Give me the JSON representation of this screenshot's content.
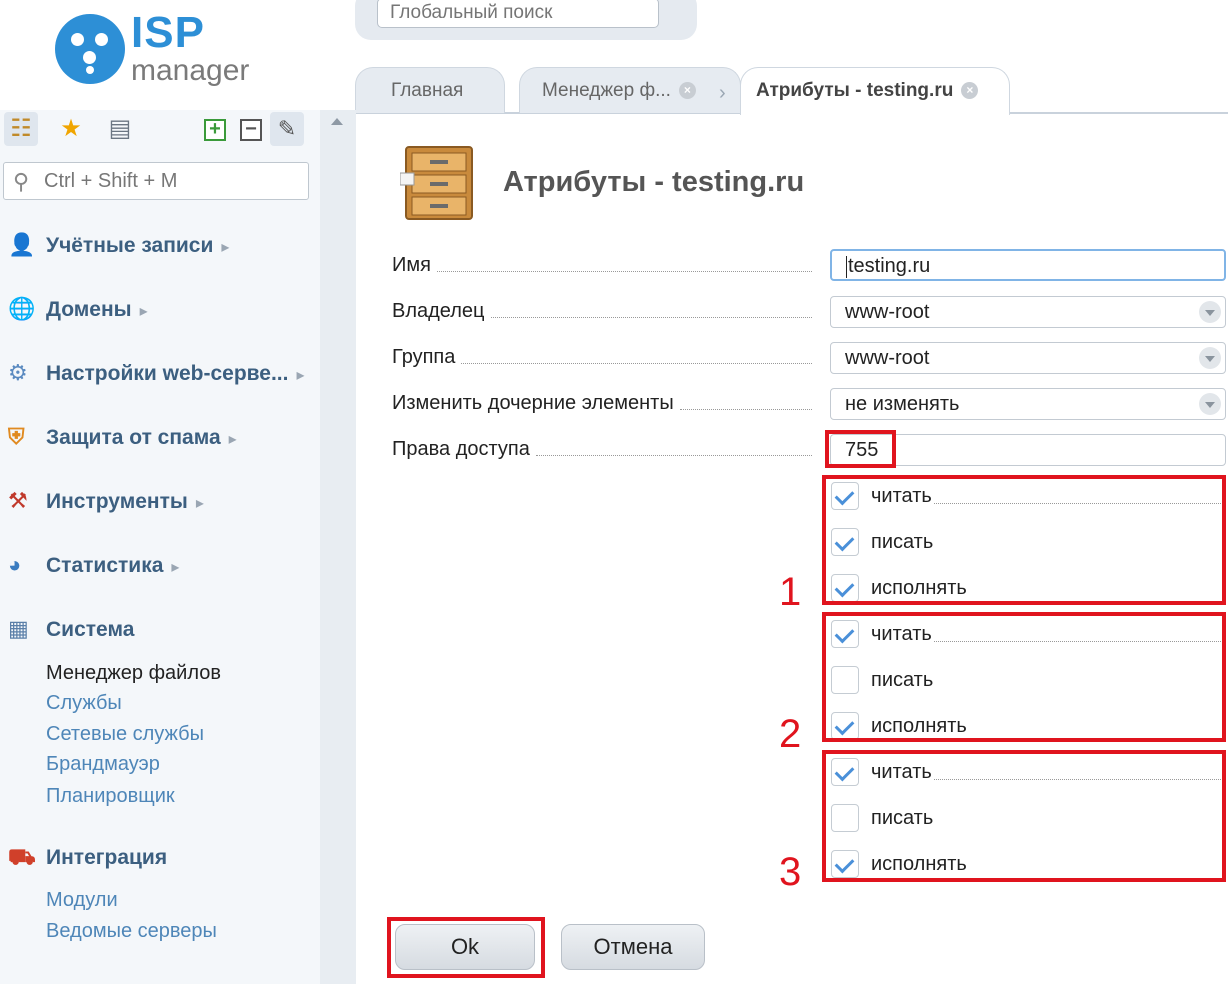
{
  "logo": {
    "brand": "ISP",
    "product": "manager"
  },
  "global_search": {
    "placeholder": "Глобальный поиск"
  },
  "tabs": [
    {
      "label": "Главная"
    },
    {
      "label": "Менеджер ф..."
    },
    {
      "label": "Атрибуты - testing.ru"
    }
  ],
  "sidebar": {
    "search_placeholder": "Ctrl + Shift + M",
    "sections": [
      {
        "label": "Учётные записи"
      },
      {
        "label": "Домены"
      },
      {
        "label": "Настройки web-серве..."
      },
      {
        "label": "Защита от спама"
      },
      {
        "label": "Инструменты"
      },
      {
        "label": "Статистика"
      },
      {
        "label": "Система",
        "items": [
          "Менеджер файлов",
          "Службы",
          "Сетевые службы",
          "Брандмауэр",
          "Планировщик"
        ]
      },
      {
        "label": "Интеграция",
        "items": [
          "Модули",
          "Ведомые серверы"
        ]
      }
    ]
  },
  "form": {
    "title": "Атрибуты - testing.ru",
    "fields": {
      "name": {
        "label": "Имя",
        "value": "testing.ru"
      },
      "owner": {
        "label": "Владелец",
        "value": "www-root"
      },
      "group": {
        "label": "Группа",
        "value": "www-root"
      },
      "children": {
        "label": "Изменить дочерние элементы",
        "value": "не изменять"
      },
      "perms": {
        "label": "Права доступа",
        "value": "755"
      }
    },
    "permission_groups": [
      {
        "number": "1",
        "items": [
          {
            "label": "читать",
            "checked": true
          },
          {
            "label": "писать",
            "checked": true
          },
          {
            "label": "исполнять",
            "checked": true
          }
        ]
      },
      {
        "number": "2",
        "items": [
          {
            "label": "читать",
            "checked": true
          },
          {
            "label": "писать",
            "checked": false
          },
          {
            "label": "исполнять",
            "checked": true
          }
        ]
      },
      {
        "number": "3",
        "items": [
          {
            "label": "читать",
            "checked": true
          },
          {
            "label": "писать",
            "checked": false
          },
          {
            "label": "исполнять",
            "checked": true
          }
        ]
      }
    ],
    "ok_label": "Ok",
    "cancel_label": "Отмена"
  },
  "colors": {
    "accent": "#2d8fd6",
    "highlight": "#e0141e",
    "nav_link": "#4e86b8",
    "nav_header": "#3c5f80"
  }
}
